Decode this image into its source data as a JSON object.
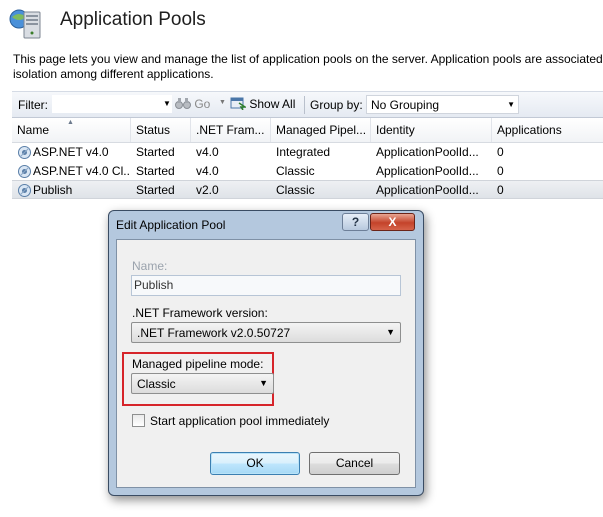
{
  "header": {
    "title": "Application Pools",
    "description_line1": "This page lets you view and manage the list of application pools on the server. Application pools are associated w",
    "description_line2": "isolation among different applications."
  },
  "toolbar": {
    "filter_label": "Filter:",
    "filter_value": "",
    "go_label": "Go",
    "show_all_label": "Show All",
    "group_by_label": "Group by:",
    "group_by_value": "No Grouping"
  },
  "grid": {
    "columns": [
      "Name",
      "Status",
      ".NET Fram...",
      "Managed Pipel...",
      "Identity",
      "Applications"
    ],
    "rows": [
      {
        "name": "ASP.NET v4.0",
        "status": "Started",
        "net": "v4.0",
        "pipeline": "Integrated",
        "identity": "ApplicationPoolId...",
        "apps": "0",
        "selected": false
      },
      {
        "name": "ASP.NET v4.0 Cl...",
        "status": "Started",
        "net": "v4.0",
        "pipeline": "Classic",
        "identity": "ApplicationPoolId...",
        "apps": "0",
        "selected": false
      },
      {
        "name": "Publish",
        "status": "Started",
        "net": "v2.0",
        "pipeline": "Classic",
        "identity": "ApplicationPoolId...",
        "apps": "0",
        "selected": true
      }
    ]
  },
  "dialog": {
    "title": "Edit Application Pool",
    "help_label": "?",
    "close_label": "X",
    "name_label": "Name:",
    "name_value": "Publish",
    "net_label": ".NET Framework version:",
    "net_value": ".NET Framework v2.0.50727",
    "pipeline_label": "Managed pipeline mode:",
    "pipeline_value": "Classic",
    "start_label": "Start application pool immediately",
    "start_checked": false,
    "ok_label": "OK",
    "cancel_label": "Cancel"
  },
  "colors": {
    "highlight": "#d6242a",
    "dialog_frame": "#b4c8de",
    "close_button": "#c4432a"
  }
}
